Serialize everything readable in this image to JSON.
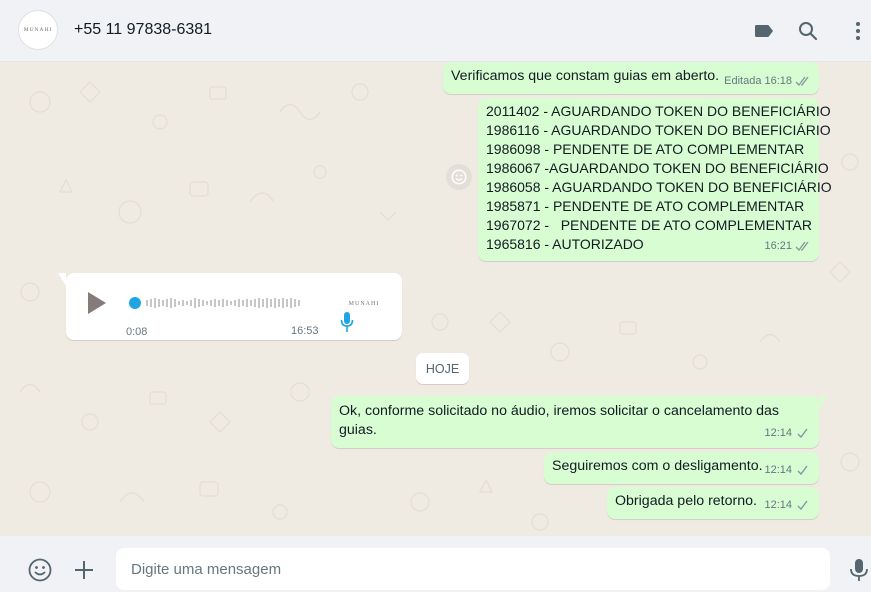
{
  "header": {
    "avatar_text": "MUNAHI",
    "contact_name": "+55 11 97838-6381"
  },
  "messages": {
    "m1": {
      "text": "Verificamos que constam guias em aberto.",
      "edited_label": "Editada",
      "time": "16:18"
    },
    "m2": {
      "lines": [
        "2011402 - AGUARDANDO TOKEN DO BENEFICIÁRIO",
        "1986116 - AGUARDANDO TOKEN DO BENEFICIÁRIO",
        "1986098 - PENDENTE DE ATO COMPLEMENTAR",
        "1986067 -AGUARDANDO TOKEN DO BENEFICIÁRIO",
        "1986058 - AGUARDANDO TOKEN DO BENEFICIÁRIO",
        "1985871 - PENDENTE DE ATO COMPLEMENTAR",
        "1967072 -   PENDENTE DE ATO COMPLEMENTAR",
        "1965816 - AUTORIZADO"
      ],
      "time": "16:21"
    },
    "voice": {
      "duration": "0:08",
      "time": "16:53",
      "avatar_text": "MUNAHI",
      "progress": 0
    },
    "day_divider": "HOJE",
    "m3": {
      "text": "Ok, conforme solicitado no áudio, iremos solicitar o cancelamento das guias.",
      "time": "12:14"
    },
    "m4": {
      "text": "Seguiremos com o desligamento.",
      "time": "12:14"
    },
    "m5": {
      "text": "Obrigada pelo retorno.",
      "time": "12:14"
    }
  },
  "footer": {
    "placeholder": "Digite uma mensagem"
  },
  "icons": {
    "label": "label-icon",
    "search": "search-icon",
    "menu": "menu-icon",
    "emoji": "emoji-icon",
    "attach": "plus-icon",
    "mic": "mic-icon"
  },
  "colors": {
    "outgoing_bubble": "#d9fdd3",
    "incoming_bubble": "#ffffff",
    "chat_background": "#efeae2",
    "read_tick": "#53bdeb",
    "header_bg": "#f0f2f5"
  }
}
